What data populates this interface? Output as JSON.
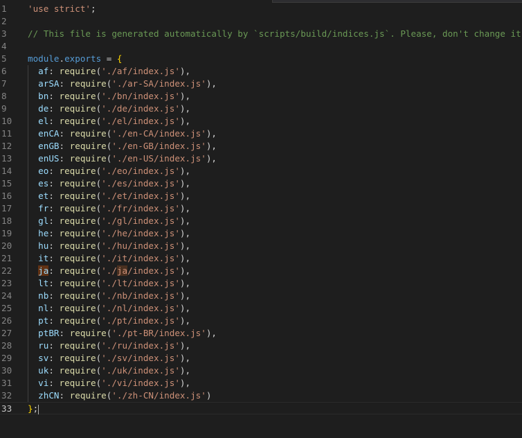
{
  "editor": {
    "lines": [
      {
        "num": "1",
        "segments": [
          {
            "t": "'use strict'",
            "c": "str"
          },
          {
            "t": ";",
            "c": "pun"
          }
        ]
      },
      {
        "num": "2",
        "segments": []
      },
      {
        "num": "3",
        "segments": [
          {
            "t": "// This file is generated automatically by `scripts/build/indices.js`. Please, don't change it.",
            "c": "cmt"
          }
        ]
      },
      {
        "num": "4",
        "segments": []
      },
      {
        "num": "5",
        "segments": [
          {
            "t": "module",
            "c": "kw"
          },
          {
            "t": ".",
            "c": "pun"
          },
          {
            "t": "exports",
            "c": "kw"
          },
          {
            "t": " = ",
            "c": "pun"
          },
          {
            "t": "{",
            "c": "brk"
          }
        ]
      },
      {
        "num": "6",
        "segments": [
          {
            "t": "  af",
            "c": "prop"
          },
          {
            "t": ": ",
            "c": "pun"
          },
          {
            "t": "require",
            "c": "fn"
          },
          {
            "t": "(",
            "c": "pun"
          },
          {
            "t": "'./af/index.js'",
            "c": "str"
          },
          {
            "t": "),",
            "c": "pun"
          }
        ]
      },
      {
        "num": "7",
        "segments": [
          {
            "t": "  arSA",
            "c": "prop"
          },
          {
            "t": ": ",
            "c": "pun"
          },
          {
            "t": "require",
            "c": "fn"
          },
          {
            "t": "(",
            "c": "pun"
          },
          {
            "t": "'./ar-SA/index.js'",
            "c": "str"
          },
          {
            "t": "),",
            "c": "pun"
          }
        ]
      },
      {
        "num": "8",
        "segments": [
          {
            "t": "  bn",
            "c": "prop"
          },
          {
            "t": ": ",
            "c": "pun"
          },
          {
            "t": "require",
            "c": "fn"
          },
          {
            "t": "(",
            "c": "pun"
          },
          {
            "t": "'./bn/index.js'",
            "c": "str"
          },
          {
            "t": "),",
            "c": "pun"
          }
        ]
      },
      {
        "num": "9",
        "segments": [
          {
            "t": "  de",
            "c": "prop"
          },
          {
            "t": ": ",
            "c": "pun"
          },
          {
            "t": "require",
            "c": "fn"
          },
          {
            "t": "(",
            "c": "pun"
          },
          {
            "t": "'./de/index.js'",
            "c": "str"
          },
          {
            "t": "),",
            "c": "pun"
          }
        ]
      },
      {
        "num": "10",
        "segments": [
          {
            "t": "  el",
            "c": "prop"
          },
          {
            "t": ": ",
            "c": "pun"
          },
          {
            "t": "require",
            "c": "fn"
          },
          {
            "t": "(",
            "c": "pun"
          },
          {
            "t": "'./el/index.js'",
            "c": "str"
          },
          {
            "t": "),",
            "c": "pun"
          }
        ]
      },
      {
        "num": "11",
        "segments": [
          {
            "t": "  enCA",
            "c": "prop"
          },
          {
            "t": ": ",
            "c": "pun"
          },
          {
            "t": "require",
            "c": "fn"
          },
          {
            "t": "(",
            "c": "pun"
          },
          {
            "t": "'./en-CA/index.js'",
            "c": "str"
          },
          {
            "t": "),",
            "c": "pun"
          }
        ]
      },
      {
        "num": "12",
        "segments": [
          {
            "t": "  enGB",
            "c": "prop"
          },
          {
            "t": ": ",
            "c": "pun"
          },
          {
            "t": "require",
            "c": "fn"
          },
          {
            "t": "(",
            "c": "pun"
          },
          {
            "t": "'./en-GB/index.js'",
            "c": "str"
          },
          {
            "t": "),",
            "c": "pun"
          }
        ]
      },
      {
        "num": "13",
        "segments": [
          {
            "t": "  enUS",
            "c": "prop"
          },
          {
            "t": ": ",
            "c": "pun"
          },
          {
            "t": "require",
            "c": "fn"
          },
          {
            "t": "(",
            "c": "pun"
          },
          {
            "t": "'./en-US/index.js'",
            "c": "str"
          },
          {
            "t": "),",
            "c": "pun"
          }
        ]
      },
      {
        "num": "14",
        "segments": [
          {
            "t": "  eo",
            "c": "prop"
          },
          {
            "t": ": ",
            "c": "pun"
          },
          {
            "t": "require",
            "c": "fn"
          },
          {
            "t": "(",
            "c": "pun"
          },
          {
            "t": "'./eo/index.js'",
            "c": "str"
          },
          {
            "t": "),",
            "c": "pun"
          }
        ]
      },
      {
        "num": "15",
        "segments": [
          {
            "t": "  es",
            "c": "prop"
          },
          {
            "t": ": ",
            "c": "pun"
          },
          {
            "t": "require",
            "c": "fn"
          },
          {
            "t": "(",
            "c": "pun"
          },
          {
            "t": "'./es/index.js'",
            "c": "str"
          },
          {
            "t": "),",
            "c": "pun"
          }
        ]
      },
      {
        "num": "16",
        "segments": [
          {
            "t": "  et",
            "c": "prop"
          },
          {
            "t": ": ",
            "c": "pun"
          },
          {
            "t": "require",
            "c": "fn"
          },
          {
            "t": "(",
            "c": "pun"
          },
          {
            "t": "'./et/index.js'",
            "c": "str"
          },
          {
            "t": "),",
            "c": "pun"
          }
        ]
      },
      {
        "num": "17",
        "segments": [
          {
            "t": "  fr",
            "c": "prop"
          },
          {
            "t": ": ",
            "c": "pun"
          },
          {
            "t": "require",
            "c": "fn"
          },
          {
            "t": "(",
            "c": "pun"
          },
          {
            "t": "'./fr/index.js'",
            "c": "str"
          },
          {
            "t": "),",
            "c": "pun"
          }
        ]
      },
      {
        "num": "18",
        "segments": [
          {
            "t": "  gl",
            "c": "prop"
          },
          {
            "t": ": ",
            "c": "pun"
          },
          {
            "t": "require",
            "c": "fn"
          },
          {
            "t": "(",
            "c": "pun"
          },
          {
            "t": "'./gl/index.js'",
            "c": "str"
          },
          {
            "t": "),",
            "c": "pun"
          }
        ]
      },
      {
        "num": "19",
        "segments": [
          {
            "t": "  he",
            "c": "prop"
          },
          {
            "t": ": ",
            "c": "pun"
          },
          {
            "t": "require",
            "c": "fn"
          },
          {
            "t": "(",
            "c": "pun"
          },
          {
            "t": "'./he/index.js'",
            "c": "str"
          },
          {
            "t": "),",
            "c": "pun"
          }
        ]
      },
      {
        "num": "20",
        "segments": [
          {
            "t": "  hu",
            "c": "prop"
          },
          {
            "t": ": ",
            "c": "pun"
          },
          {
            "t": "require",
            "c": "fn"
          },
          {
            "t": "(",
            "c": "pun"
          },
          {
            "t": "'./hu/index.js'",
            "c": "str"
          },
          {
            "t": "),",
            "c": "pun"
          }
        ]
      },
      {
        "num": "21",
        "segments": [
          {
            "t": "  it",
            "c": "prop"
          },
          {
            "t": ": ",
            "c": "pun"
          },
          {
            "t": "require",
            "c": "fn"
          },
          {
            "t": "(",
            "c": "pun"
          },
          {
            "t": "'./it/index.js'",
            "c": "str"
          },
          {
            "t": "),",
            "c": "pun"
          }
        ]
      },
      {
        "num": "22",
        "segments": [
          {
            "t": "  ",
            "c": "prop"
          },
          {
            "t": "ja",
            "c": "prop hl"
          },
          {
            "t": ": ",
            "c": "pun"
          },
          {
            "t": "require",
            "c": "fn"
          },
          {
            "t": "(",
            "c": "pun"
          },
          {
            "t": "'./",
            "c": "str"
          },
          {
            "t": "ja",
            "c": "str hl-soft"
          },
          {
            "t": "/index.js'",
            "c": "str"
          },
          {
            "t": "),",
            "c": "pun"
          }
        ]
      },
      {
        "num": "23",
        "segments": [
          {
            "t": "  lt",
            "c": "prop"
          },
          {
            "t": ": ",
            "c": "pun"
          },
          {
            "t": "require",
            "c": "fn"
          },
          {
            "t": "(",
            "c": "pun"
          },
          {
            "t": "'./lt/index.js'",
            "c": "str"
          },
          {
            "t": "),",
            "c": "pun"
          }
        ]
      },
      {
        "num": "24",
        "segments": [
          {
            "t": "  nb",
            "c": "prop"
          },
          {
            "t": ": ",
            "c": "pun"
          },
          {
            "t": "require",
            "c": "fn"
          },
          {
            "t": "(",
            "c": "pun"
          },
          {
            "t": "'./nb/index.js'",
            "c": "str"
          },
          {
            "t": "),",
            "c": "pun"
          }
        ]
      },
      {
        "num": "25",
        "segments": [
          {
            "t": "  nl",
            "c": "prop"
          },
          {
            "t": ": ",
            "c": "pun"
          },
          {
            "t": "require",
            "c": "fn"
          },
          {
            "t": "(",
            "c": "pun"
          },
          {
            "t": "'./nl/index.js'",
            "c": "str"
          },
          {
            "t": "),",
            "c": "pun"
          }
        ]
      },
      {
        "num": "26",
        "segments": [
          {
            "t": "  pt",
            "c": "prop"
          },
          {
            "t": ": ",
            "c": "pun"
          },
          {
            "t": "require",
            "c": "fn"
          },
          {
            "t": "(",
            "c": "pun"
          },
          {
            "t": "'./pt/index.js'",
            "c": "str"
          },
          {
            "t": "),",
            "c": "pun"
          }
        ]
      },
      {
        "num": "27",
        "segments": [
          {
            "t": "  ptBR",
            "c": "prop"
          },
          {
            "t": ": ",
            "c": "pun"
          },
          {
            "t": "require",
            "c": "fn"
          },
          {
            "t": "(",
            "c": "pun"
          },
          {
            "t": "'./pt-BR/index.js'",
            "c": "str"
          },
          {
            "t": "),",
            "c": "pun"
          }
        ]
      },
      {
        "num": "28",
        "segments": [
          {
            "t": "  ru",
            "c": "prop"
          },
          {
            "t": ": ",
            "c": "pun"
          },
          {
            "t": "require",
            "c": "fn"
          },
          {
            "t": "(",
            "c": "pun"
          },
          {
            "t": "'./ru/index.js'",
            "c": "str"
          },
          {
            "t": "),",
            "c": "pun"
          }
        ]
      },
      {
        "num": "29",
        "segments": [
          {
            "t": "  sv",
            "c": "prop"
          },
          {
            "t": ": ",
            "c": "pun"
          },
          {
            "t": "require",
            "c": "fn"
          },
          {
            "t": "(",
            "c": "pun"
          },
          {
            "t": "'./sv/index.js'",
            "c": "str"
          },
          {
            "t": "),",
            "c": "pun"
          }
        ]
      },
      {
        "num": "30",
        "segments": [
          {
            "t": "  uk",
            "c": "prop"
          },
          {
            "t": ": ",
            "c": "pun"
          },
          {
            "t": "require",
            "c": "fn"
          },
          {
            "t": "(",
            "c": "pun"
          },
          {
            "t": "'./uk/index.js'",
            "c": "str"
          },
          {
            "t": "),",
            "c": "pun"
          }
        ]
      },
      {
        "num": "31",
        "segments": [
          {
            "t": "  vi",
            "c": "prop"
          },
          {
            "t": ": ",
            "c": "pun"
          },
          {
            "t": "require",
            "c": "fn"
          },
          {
            "t": "(",
            "c": "pun"
          },
          {
            "t": "'./vi/index.js'",
            "c": "str"
          },
          {
            "t": "),",
            "c": "pun"
          }
        ]
      },
      {
        "num": "32",
        "segments": [
          {
            "t": "  zhCN",
            "c": "prop"
          },
          {
            "t": ": ",
            "c": "pun"
          },
          {
            "t": "require",
            "c": "fn"
          },
          {
            "t": "(",
            "c": "pun"
          },
          {
            "t": "'./zh-CN/index.js'",
            "c": "str"
          },
          {
            "t": ")",
            "c": "pun"
          }
        ]
      },
      {
        "num": "33",
        "segments": [
          {
            "t": "}",
            "c": "brk"
          },
          {
            "t": ";",
            "c": "pun"
          }
        ],
        "cursor": true,
        "current": true
      }
    ]
  },
  "colors": {
    "background": "#1e1e1e",
    "string": "#ce9178",
    "comment": "#6a9955",
    "keyword": "#569cd6",
    "property": "#9cdcfe",
    "function": "#dcdcaa",
    "bracket": "#ffd700",
    "match_highlight": "#613214"
  }
}
